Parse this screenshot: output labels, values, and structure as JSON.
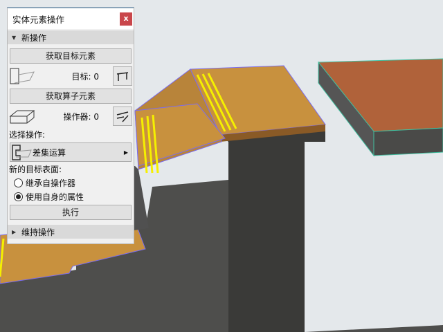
{
  "window": {
    "title": "实体元素操作",
    "close_label": "x"
  },
  "new_ops": {
    "header": "新操作",
    "get_target_label": "获取目标元素",
    "target_count": "目标: 0",
    "get_operator_label": "获取算子元素",
    "operator_count": "操作器: 0",
    "select_op_label": "选择操作:",
    "operation_value": "差集运算",
    "new_surface_label": "新的目标表面:",
    "radio_options": [
      {
        "label": "继承自操作器",
        "selected": false
      },
      {
        "label": "使用自身的属性",
        "selected": true
      }
    ],
    "execute_label": "执行"
  },
  "maintain_ops": {
    "header": "维持操作"
  },
  "colors": {
    "close": "#c9464b",
    "background": "#e4e8eb",
    "wood": "#c8913e",
    "stripe": "#f5f000",
    "outline": "#7b6cf0"
  }
}
